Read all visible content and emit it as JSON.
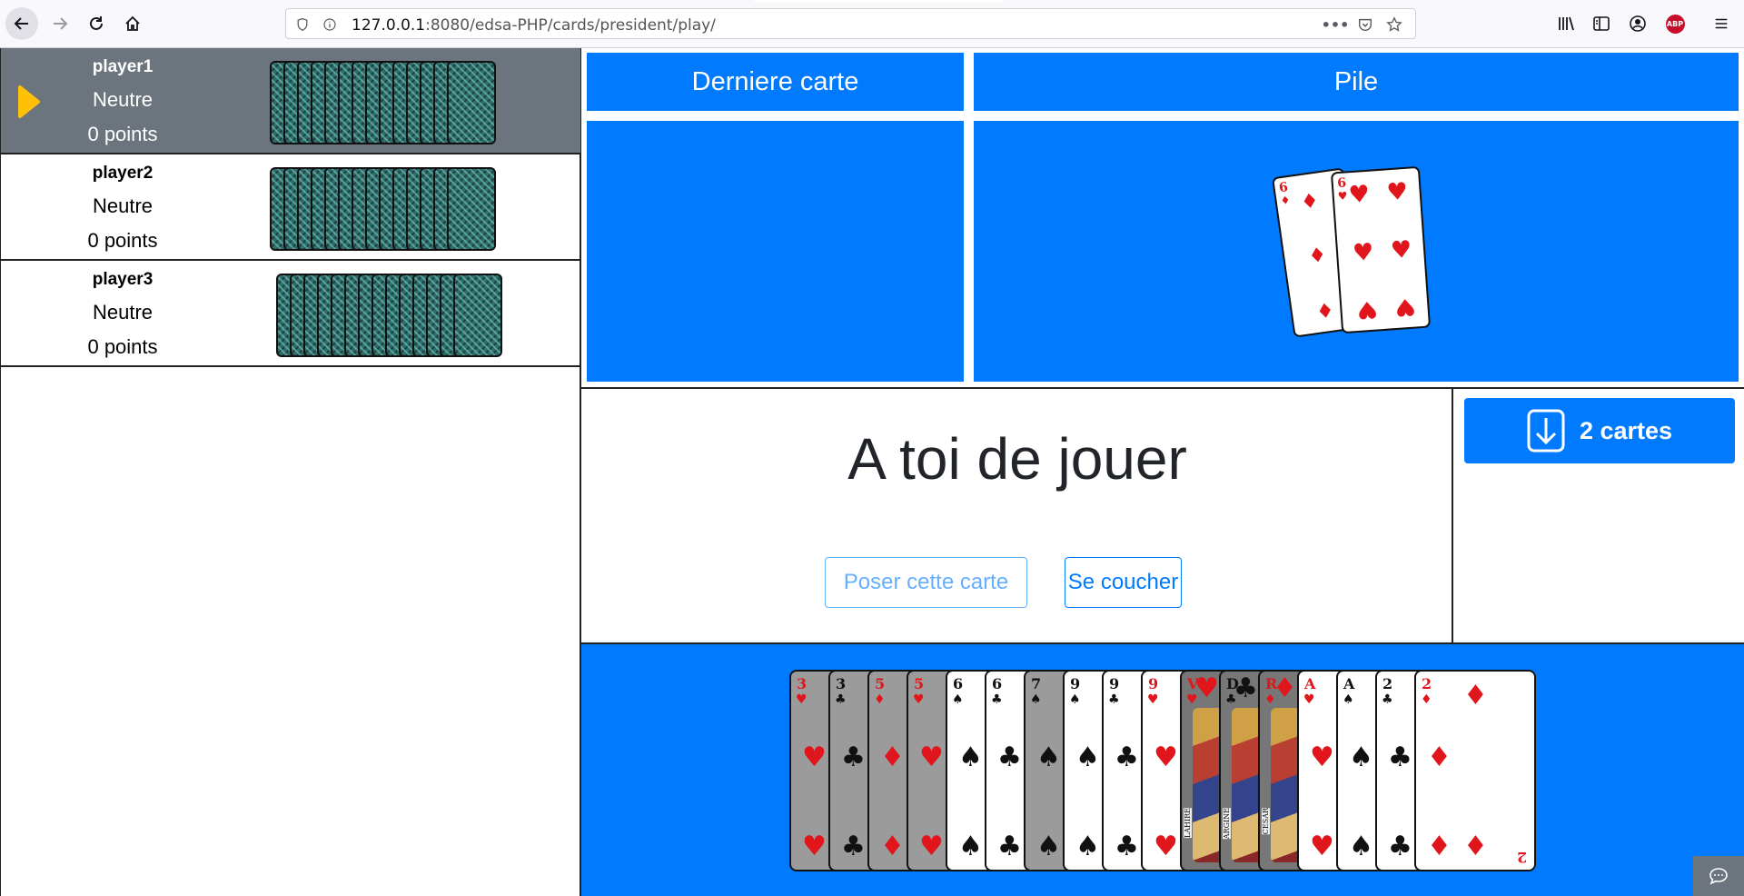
{
  "browser": {
    "url_host": "127.0.0.1",
    "url_rest": ":8080/edsa-PHP/cards/president/play/",
    "more_icon": "more-horizontal-icon",
    "pocket_icon": "pocket-icon",
    "bookmark_icon": "star-icon",
    "abp_label": "ABP"
  },
  "players": [
    {
      "name": "player1",
      "status": "Neutre",
      "points": "0 points",
      "active": true,
      "cards": 14
    },
    {
      "name": "player2",
      "status": "Neutre",
      "points": "0 points",
      "active": false,
      "cards": 14
    },
    {
      "name": "player3",
      "status": "Neutre",
      "points": "0 points",
      "active": false,
      "cards": 14
    }
  ],
  "board": {
    "last_card_title": "Derniere carte",
    "pile_title": "Pile",
    "pile_cards": [
      {
        "rank": "6",
        "suit": "♦"
      },
      {
        "rank": "6",
        "suit": "♥"
      }
    ]
  },
  "turn": {
    "message": "A toi de jouer",
    "play_button": "Poser cette carte",
    "pass_button": "Se coucher",
    "draw_button": "2 cartes"
  },
  "hand": [
    {
      "rank": "3",
      "suit": "♥",
      "color": "red",
      "grey": true
    },
    {
      "rank": "3",
      "suit": "♣",
      "color": "blk",
      "grey": true
    },
    {
      "rank": "5",
      "suit": "♦",
      "color": "red",
      "grey": true
    },
    {
      "rank": "5",
      "suit": "♥",
      "color": "red",
      "grey": true
    },
    {
      "rank": "6",
      "suit": "♠",
      "color": "blk",
      "grey": false
    },
    {
      "rank": "6",
      "suit": "♣",
      "color": "blk",
      "grey": false
    },
    {
      "rank": "7",
      "suit": "♠",
      "color": "blk",
      "grey": true
    },
    {
      "rank": "9",
      "suit": "♠",
      "color": "blk",
      "grey": false
    },
    {
      "rank": "9",
      "suit": "♣",
      "color": "blk",
      "grey": false
    },
    {
      "rank": "9",
      "suit": "♥",
      "color": "red",
      "grey": false
    },
    {
      "rank": "V",
      "suit": "♥",
      "color": "red",
      "grey": true,
      "face": true,
      "face_name": "LAHIRE"
    },
    {
      "rank": "D",
      "suit": "♣",
      "color": "blk",
      "grey": true,
      "face": true,
      "face_name": "ARGINE"
    },
    {
      "rank": "R",
      "suit": "♦",
      "color": "red",
      "grey": true,
      "face": true,
      "face_name": "CESAR"
    },
    {
      "rank": "A",
      "suit": "♥",
      "color": "red",
      "grey": false
    },
    {
      "rank": "A",
      "suit": "♠",
      "color": "blk",
      "grey": false
    },
    {
      "rank": "2",
      "suit": "♣",
      "color": "blk",
      "grey": false
    },
    {
      "rank": "2",
      "suit": "♦",
      "color": "red",
      "grey": false
    }
  ],
  "colors": {
    "primary": "#007bff",
    "active_row": "#6c757d",
    "turn_arrow": "#ffc107"
  }
}
